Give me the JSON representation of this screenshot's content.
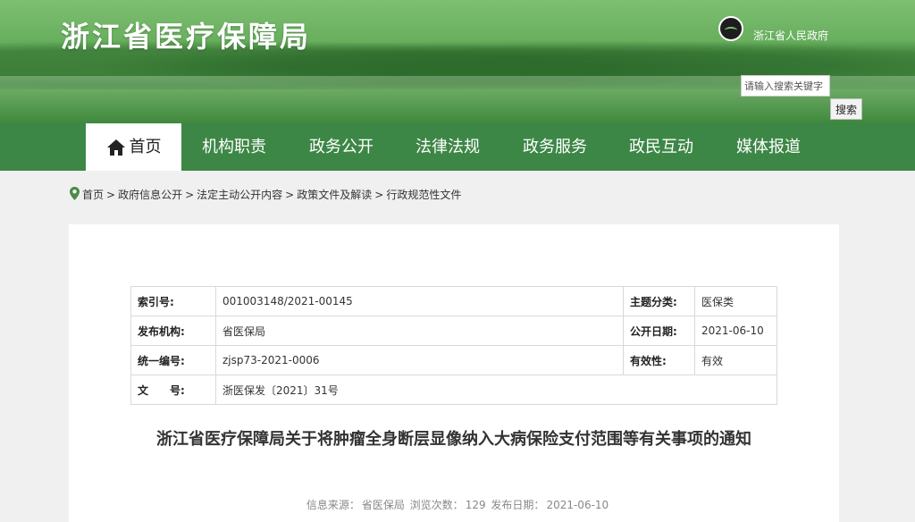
{
  "header": {
    "site_title": "浙江省医疗保障局",
    "gov_link": "浙江省人民政府",
    "search_placeholder": "请输入搜索关键字",
    "search_button": "搜索"
  },
  "nav": {
    "items": [
      {
        "label": "首页",
        "icon": "home-icon",
        "active": true
      },
      {
        "label": "机构职责"
      },
      {
        "label": "政务公开"
      },
      {
        "label": "法律法规"
      },
      {
        "label": "政务服务"
      },
      {
        "label": "政民互动"
      },
      {
        "label": "媒体报道"
      }
    ]
  },
  "breadcrumb": {
    "icon": "location-pin-icon",
    "items": [
      "首页",
      "政府信息公开",
      "法定主动公开内容",
      "政策文件及解读",
      "行政规范性文件"
    ],
    "separator": ">"
  },
  "meta": {
    "index_label": "索引号:",
    "index_value": "001003148/2021-00145",
    "topic_label": "主题分类:",
    "topic_value": "医保类",
    "issuer_label": "发布机构:",
    "issuer_value": "省医保局",
    "date_label": "公开日期:",
    "date_value": "2021-06-10",
    "code_label": "统一编号:",
    "code_value": "zjsp73-2021-0006",
    "validity_label": "有效性:",
    "validity_value": "有效",
    "docno_label": "文　　号:",
    "docno_value": "浙医保发〔2021〕31号"
  },
  "document": {
    "title": "浙江省医疗保障局关于将肿瘤全身断层显像纳入大病保险支付范围等有关事项的通知",
    "source_label": "信息来源：",
    "source_value": "省医保局",
    "views_label": "浏览次数：",
    "views_value": "129",
    "date_label": "发布日期：",
    "date_value": "2021-06-10"
  },
  "colors": {
    "nav_bg": "#3d8746",
    "banner": "#5fa956"
  }
}
